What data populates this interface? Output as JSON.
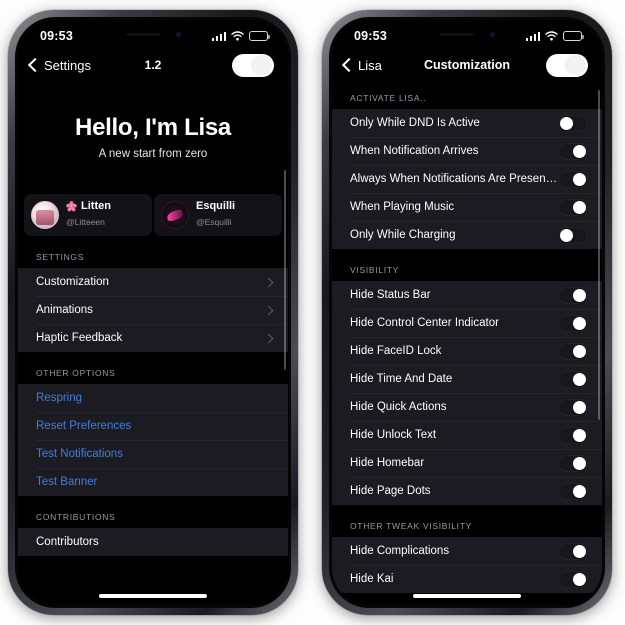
{
  "app": {
    "name": "Lisa",
    "version_label": "1.2"
  },
  "left_phone": {
    "status_bar": {
      "time": "09:53",
      "signal_icon": "cellular-signal-icon",
      "wifi_icon": "wifi-icon",
      "battery_icon": "battery-icon"
    },
    "nav": {
      "back_label": "Settings",
      "back_icon": "chevron-left-icon",
      "title": "1.2",
      "master_toggle": "on"
    },
    "hero": {
      "heading": "Hello, I'm Lisa",
      "subheading": "A new start from zero"
    },
    "developers": [
      {
        "name": "Litten",
        "handle": "@Litteeen",
        "avatar_icon": "litten-avatar",
        "badge_icon": "cherry-blossom-icon"
      },
      {
        "name": "Esquilli",
        "handle": "@Esquilli",
        "avatar_icon": "esquilli-avatar",
        "badge_icon": ""
      }
    ],
    "sections": [
      {
        "header": "SETTINGS",
        "style": "disclosure",
        "rows": [
          {
            "label": "Customization",
            "accessory": "chevron-right-icon"
          },
          {
            "label": "Animations",
            "accessory": "chevron-right-icon"
          },
          {
            "label": "Haptic Feedback",
            "accessory": "chevron-right-icon"
          }
        ]
      },
      {
        "header": "OTHER OPTIONS",
        "style": "action",
        "rows": [
          {
            "label": "Respring",
            "accessory": ""
          },
          {
            "label": "Reset Preferences",
            "accessory": ""
          },
          {
            "label": "Test Notifications",
            "accessory": ""
          },
          {
            "label": "Test Banner",
            "accessory": ""
          }
        ]
      },
      {
        "header": "CONTRIBUTIONS",
        "style": "disclosure",
        "rows": [
          {
            "label": "Contributors",
            "accessory": ""
          }
        ]
      }
    ]
  },
  "right_phone": {
    "status_bar": {
      "time": "09:53",
      "signal_icon": "cellular-signal-icon",
      "wifi_icon": "wifi-icon",
      "battery_icon": "battery-icon"
    },
    "nav": {
      "back_label": "Lisa",
      "back_icon": "chevron-left-icon",
      "title": "Customization",
      "master_toggle": "on"
    },
    "sections": [
      {
        "header": "ACTIVATE LISA..",
        "rows": [
          {
            "label": "Only While DND Is Active",
            "toggle": "off"
          },
          {
            "label": "When Notification Arrives",
            "toggle": "on"
          },
          {
            "label": "Always When Notifications Are Present...",
            "toggle": "on"
          },
          {
            "label": "When Playing Music",
            "toggle": "on"
          },
          {
            "label": "Only While Charging",
            "toggle": "off"
          }
        ]
      },
      {
        "header": "VISIBILITY",
        "rows": [
          {
            "label": "Hide Status Bar",
            "toggle": "on"
          },
          {
            "label": "Hide Control Center Indicator",
            "toggle": "on"
          },
          {
            "label": "Hide FaceID Lock",
            "toggle": "on"
          },
          {
            "label": "Hide Time And Date",
            "toggle": "on"
          },
          {
            "label": "Hide Quick Actions",
            "toggle": "on"
          },
          {
            "label": "Hide Unlock Text",
            "toggle": "on"
          },
          {
            "label": "Hide Homebar",
            "toggle": "on"
          },
          {
            "label": "Hide Page Dots",
            "toggle": "on"
          }
        ]
      },
      {
        "header": "OTHER TWEAK VISIBILITY",
        "rows": [
          {
            "label": "Hide Complications",
            "toggle": "on"
          },
          {
            "label": "Hide Kai",
            "toggle": "on"
          }
        ]
      }
    ]
  },
  "colors": {
    "screen_background": "#000000",
    "row_background": "#1b1b21",
    "accent_link": "#3f7fe0",
    "section_header_text": "#9a9aa0",
    "toggle_knob": "#ffffff"
  }
}
